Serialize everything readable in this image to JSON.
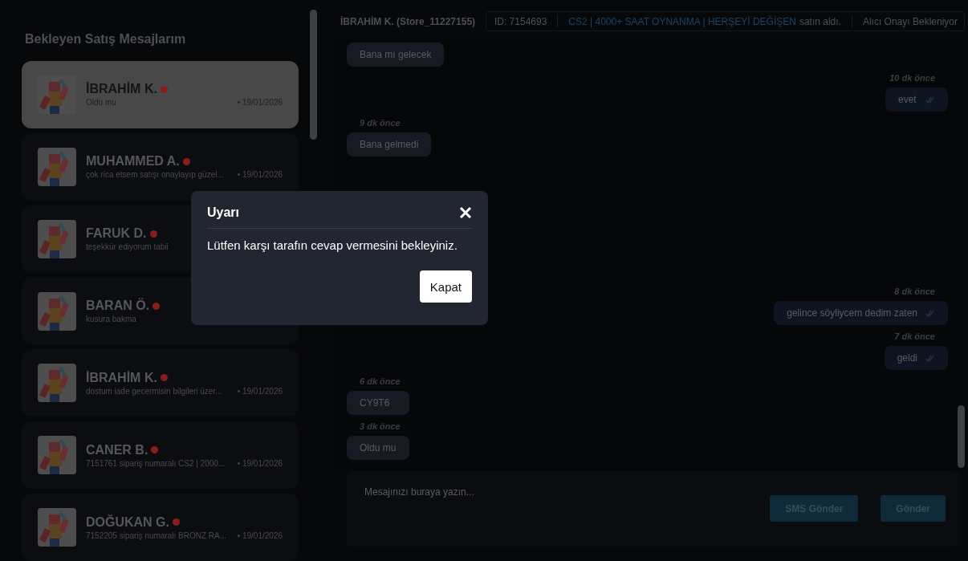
{
  "sidebar": {
    "title": "Bekleyen Satış Mesajlarım",
    "conversations": [
      {
        "name": "İBRAHİM K.",
        "preview": "Oldu mu",
        "date": "• 19/01/2026",
        "unread": true,
        "selected": true
      },
      {
        "name": "MUHAMMED A.",
        "preview": "çok rica etsem satışı onaylayıp güzel...",
        "date": "• 19/01/2026",
        "unread": true,
        "selected": false
      },
      {
        "name": "FARUK D.",
        "preview": "teşekkür ediyorum tabii",
        "unread": true,
        "selected": false
      },
      {
        "name": "BARAN Ö.",
        "preview": "kusura bakma",
        "unread": true,
        "selected": false
      },
      {
        "name": "İBRAHİM K.",
        "preview": "dostum iade gecermisin bilgileri üzer...",
        "date": "• 19/01/2026",
        "unread": true,
        "selected": false
      },
      {
        "name": "CANER B.",
        "preview": "7151761 sipariş numaralı CS2 | 2000...",
        "date": "• 19/01/2026",
        "unread": true,
        "selected": false
      },
      {
        "name": "DOĞUKAN G.",
        "preview": "7152205 sipariş numaralı BRONZ RA...",
        "date": "• 19/01/2026",
        "unread": true,
        "selected": false
      }
    ]
  },
  "chat": {
    "contact": "İBRAHİM K. (Store_11227155)",
    "order_id": "ID: 7154693",
    "product": "CS2 | 4000+ SAAT OYNANMA | HERŞEYİ DEĞİŞEN",
    "purchased": "satın aldı.",
    "status": "Alıcı Onayı Bekleniyor",
    "messages": [
      {
        "kind": "incoming",
        "text": "Bana mı gelecek"
      },
      {
        "kind": "outgoing",
        "time": "10 dk önce",
        "text": "evet"
      },
      {
        "kind": "incoming",
        "time": "9 dk önce",
        "text": "Bana gelmedi"
      },
      {
        "kind": "outgoing",
        "time": "8 dk önce",
        "text": "gelince söyliycem dedim zaten"
      },
      {
        "kind": "outgoing",
        "time": "7 dk önce",
        "text": "geldi"
      },
      {
        "kind": "incoming",
        "time": "6 dk önce",
        "text": "CY9T6"
      },
      {
        "kind": "incoming",
        "time": "3 dk önce",
        "text": "Oldu mu"
      }
    ],
    "composer": {
      "placeholder": "Mesajınızı buraya yazın...",
      "buttons": [
        "SMS Gönder",
        "Gönder"
      ]
    }
  },
  "dialog": {
    "title": "Uyarı",
    "message": "Lütfen karşı tarafın cevap vermesini bekleyiniz.",
    "button": "Kapat"
  }
}
